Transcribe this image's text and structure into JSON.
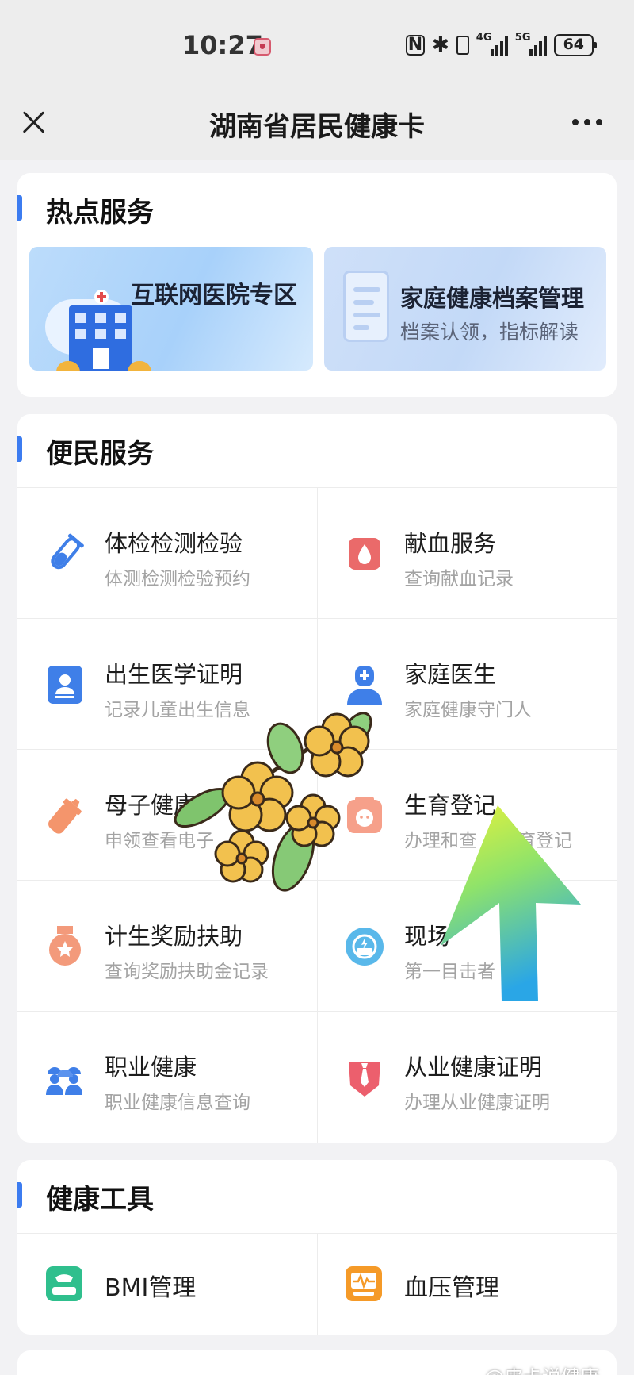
{
  "status_bar": {
    "time": "10:27",
    "network_1": "4G",
    "network_2": "5G",
    "battery": "64"
  },
  "title_bar": {
    "title": "湖南省居民健康卡"
  },
  "hot_services": {
    "title": "热点服务",
    "banners": [
      {
        "title": "互联网医院专区"
      },
      {
        "title": "家庭健康档案管理",
        "subtitle": "档案认领，指标解读"
      }
    ]
  },
  "convenience_services": {
    "title": "便民服务",
    "items": [
      {
        "title": "体检检测检验",
        "subtitle": "体测检测检验预约",
        "icon": "test-tube-icon"
      },
      {
        "title": "献血服务",
        "subtitle": "查询献血记录",
        "icon": "blood-drop-icon"
      },
      {
        "title": "出生医学证明",
        "subtitle": "记录儿童出生信息",
        "icon": "birth-certificate-icon"
      },
      {
        "title": "家庭医生",
        "subtitle": "家庭健康守门人",
        "icon": "doctor-icon"
      },
      {
        "title": "母子健康手",
        "subtitle": "申领查看电子",
        "icon": "baby-bottle-icon"
      },
      {
        "title": "生育登记",
        "subtitle": "办理和查",
        "subtitle_tail": "生育登记",
        "icon": "baby-icon"
      },
      {
        "title": "计生奖励扶助",
        "subtitle": "查询奖励扶助金记录",
        "icon": "medal-icon"
      },
      {
        "title": "现场",
        "subtitle": "第一目击者",
        "icon": "sos-icon"
      },
      {
        "title": "职业健康",
        "subtitle": "职业健康信息查询",
        "icon": "workers-icon"
      },
      {
        "title": "从业健康证明",
        "subtitle": "办理从业健康证明",
        "icon": "tie-icon"
      }
    ]
  },
  "health_tools": {
    "title": "健康工具",
    "items": [
      {
        "label": "BMI管理",
        "icon": "scale-icon"
      },
      {
        "label": "血压管理",
        "icon": "blood-pressure-icon"
      }
    ]
  },
  "watermark": "@皮卡说健康",
  "colors": {
    "accent": "#3c7cf0",
    "page_bg": "#f2f2f4",
    "subtitle_gray": "#a3a3a3"
  }
}
